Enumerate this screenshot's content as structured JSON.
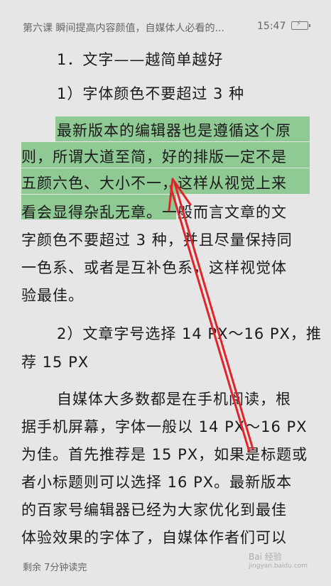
{
  "status_bar": {
    "chapter_title": "第六课 瞬间提高内容颜值，自媒体人必看的...",
    "time": "15:47"
  },
  "article": {
    "heading": "1．文字——越简单越好",
    "section1_heading": "1）字体颜色不要超过 3 种",
    "p1_lines": [
      "最新版本的编辑器也是遵循这个原",
      "则，所谓大道至简，好的排版一定不是",
      "五颜六色、大小不一，这样从视觉上来",
      "看会显得杂乱无章。一般而言文章的文",
      "字颜色不要超过 3 种，并且尽量保持同",
      "一色系、或者是互补色系，这样视觉体",
      "验最佳。"
    ],
    "section2_heading_lines": [
      "2）文章字号选择 14 PX～16 PX，推",
      "荐 15 PX"
    ],
    "p2_lines": [
      "自媒体大多数都是在手机阅读，根",
      "据手机屏幕，字体一般以 14 PX～16 PX",
      "为佳。首先推荐是 15 PX，如果是标题或",
      "者小标题则可以选择 16 PX。最新版本",
      "的百家号编辑器已经为大家优化到最佳",
      "体验效果的字体了，自媒体作者们可以"
    ]
  },
  "footer": {
    "remaining": "剩余 7分钟读完"
  },
  "watermark": {
    "brand": "Bai 经验",
    "url": "jingyan.baidu.com"
  },
  "colors": {
    "background": "#e6e6e6",
    "highlight": "#8fc993",
    "annotation_arrow": "#e0242a"
  }
}
